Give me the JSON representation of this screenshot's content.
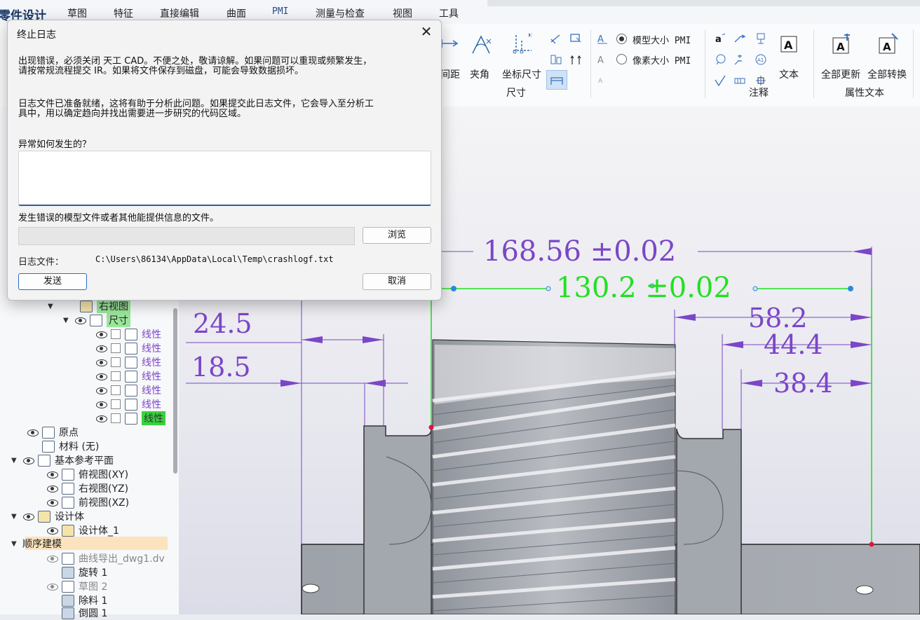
{
  "app": {
    "title": "零件设计"
  },
  "menu": [
    "草图",
    "特征",
    "直接编辑",
    "曲面",
    "PMI",
    "测量与检查",
    "视图",
    "工具"
  ],
  "ribbon": {
    "partial_label": "间距",
    "angle_label": "夹角",
    "coord_dim_label": "坐标尺寸",
    "dim_group_label": "尺寸",
    "model_pmi_label": "模型大小 PMI",
    "pixel_pmi_label": "像素大小 PMI",
    "annotation_group_label": "注释",
    "text_label": "文本",
    "update_all_label": "全部更新",
    "convert_all_label": "全部转换",
    "attr_text_group_label": "属性文本"
  },
  "tree": {
    "right_view": "右视图",
    "dimension": "尺寸",
    "linear_items": [
      "线性",
      "线性",
      "线性",
      "线性",
      "线性",
      "线性",
      "线性"
    ],
    "origin": "原点",
    "material": "材料 (无)",
    "base_planes": "基本参考平面",
    "top_plane": "俯视图(XY)",
    "right_plane": "右视图(YZ)",
    "front_plane": "前视图(XZ)",
    "design_body": "设计体",
    "design_body_1": "设计体_1",
    "sequential": "顺序建模",
    "curve_export": "曲线导出_dwg1.dv",
    "revolve": "旋转 1",
    "sketch2": "草图 2",
    "cut": "除料 1",
    "chamfer": "倒圆 1"
  },
  "dims": {
    "d1": "168.56 ±0.02",
    "d2": "130.2 ±0.02",
    "d3": "58.2",
    "d4": "44.4",
    "d5": "38.4",
    "d6": "24.5",
    "d7": "18.5"
  },
  "dialog": {
    "title": "终止日志",
    "msg1_line1": "出现错误，必须关闭 天工 CAD。不便之处，敬请谅解。如果问题可以重现或频繁发生，",
    "msg1_line2": "请按常规流程提交 IR。如果将文件保存到磁盘，可能会导致数据损坏。",
    "msg2_line1": "日志文件已准备就绪，这将有助于分析此问题。如果提交此日志文件，它会导入至分析工",
    "msg2_line2": "具中，用以确定趋向并找出需要进一步研究的代码区域。",
    "how_label": "异常如何发生的？",
    "how_value": "",
    "files_label": "发生错误的模型文件或者其他能提供信息的文件。",
    "file_value": "",
    "browse_label": "浏览",
    "log_label": "日志文件：",
    "log_path": "C:\\Users\\86134\\AppData\\Local\\Temp\\crashlogf.txt",
    "send_label": "发送",
    "cancel_label": "取消"
  },
  "colors": {
    "dim_purple": "#7b46c8",
    "dim_green": "#22e022",
    "part_gray": "#a7aab0"
  }
}
